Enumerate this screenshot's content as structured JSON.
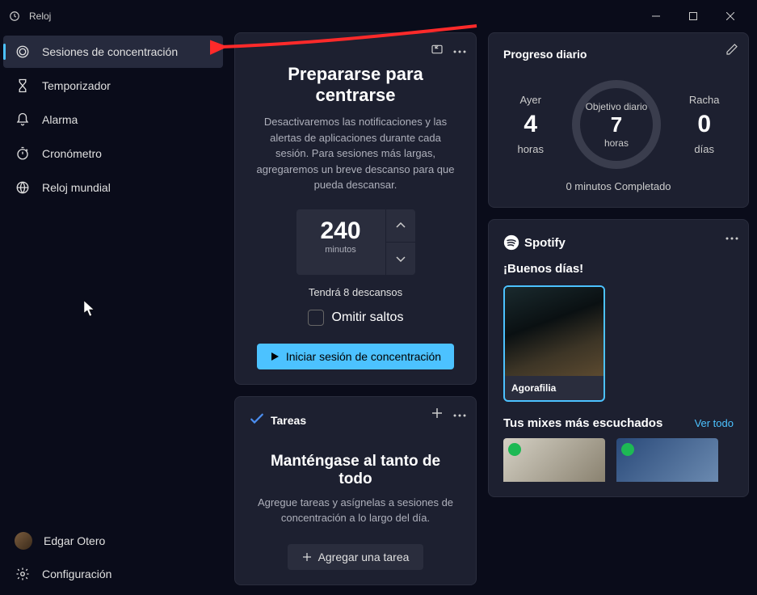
{
  "app": {
    "title": "Reloj"
  },
  "sidebar": {
    "items": [
      {
        "label": "Sesiones de concentración"
      },
      {
        "label": "Temporizador"
      },
      {
        "label": "Alarma"
      },
      {
        "label": "Cronómetro"
      },
      {
        "label": "Reloj mundial"
      }
    ],
    "user": "Edgar Otero",
    "settings": "Configuración"
  },
  "focus": {
    "title": "Prepararse para centrarse",
    "desc": "Desactivaremos las notificaciones y las alertas de aplicaciones durante cada sesión. Para sesiones más largas, agregaremos un breve descanso para que pueda descansar.",
    "value": "240",
    "unit": "minutos",
    "breaks": "Tendrá 8 descansos",
    "skip": "Omitir saltos",
    "start": "Iniciar sesión de concentración"
  },
  "tasks": {
    "header": "Tareas",
    "title": "Manténgase al tanto de todo",
    "desc": "Agregue tareas y asígnelas a sesiones de concentración a lo largo del día.",
    "add": "Agregar una tarea"
  },
  "progress": {
    "title": "Progreso diario",
    "yesterday_label": "Ayer",
    "yesterday_value": "4",
    "yesterday_unit": "horas",
    "goal_label": "Objetivo diario",
    "goal_value": "7",
    "goal_unit": "horas",
    "streak_label": "Racha",
    "streak_value": "0",
    "streak_unit": "días",
    "footer": "0 minutos Completado"
  },
  "spotify": {
    "brand": "Spotify",
    "greeting": "¡Buenos días!",
    "playlist_name": "Agorafilia",
    "mixes_title": "Tus mixes más escuchados",
    "mixes_link": "Ver todo"
  }
}
